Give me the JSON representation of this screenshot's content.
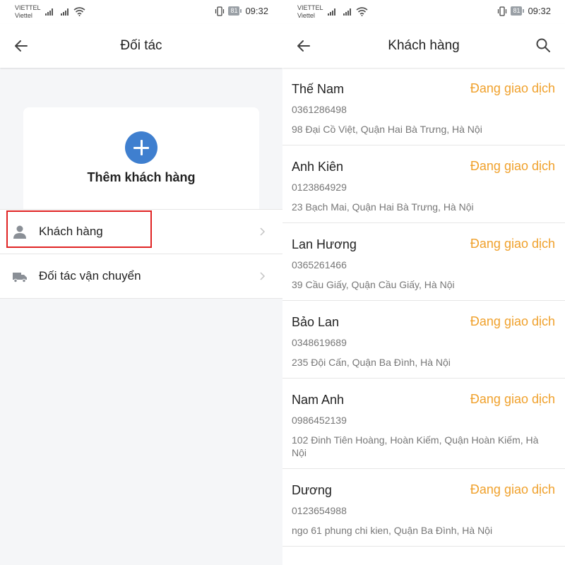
{
  "status_left": {
    "carrier_top": "VIETTEL",
    "carrier_bottom": "Viettel",
    "battery": "81",
    "time": "09:32"
  },
  "status_right": {
    "carrier_top": "VIETTEL",
    "carrier_bottom": "Viettel",
    "battery": "81",
    "time": "09:32"
  },
  "partners_screen": {
    "title": "Đối tác",
    "add_customer_label": "Thêm khách hàng",
    "menu": [
      {
        "label": "Khách hàng",
        "icon": "person-icon"
      },
      {
        "label": "Đối tác vận chuyển",
        "icon": "truck-icon"
      }
    ],
    "highlight_color": "#e02424"
  },
  "customers_screen": {
    "title": "Khách hàng",
    "status_color": "#f0a12c",
    "customers": [
      {
        "name": "Thế Nam",
        "status": "Đang giao dịch",
        "phone": "0361286498",
        "address": "98 Đại Cồ Việt, Quận Hai Bà Trưng, Hà Nội"
      },
      {
        "name": "Anh Kiên",
        "status": "Đang giao dịch",
        "phone": "0123864929",
        "address": "23 Bạch Mai, Quận Hai Bà Trưng, Hà Nội"
      },
      {
        "name": "Lan Hương",
        "status": "Đang giao dịch",
        "phone": "0365261466",
        "address": "39 Cầu Giấy, Quận Cầu Giấy, Hà Nội"
      },
      {
        "name": "Bảo Lan",
        "status": "Đang giao dịch",
        "phone": "0348619689",
        "address": "235 Đội Cấn, Quận Ba Đình, Hà Nội"
      },
      {
        "name": "Nam Anh",
        "status": "Đang giao dịch",
        "phone": "0986452139",
        "address": "102 Đinh Tiên Hoàng, Hoàn Kiếm, Quận Hoàn Kiếm, Hà Nội"
      },
      {
        "name": "Dương",
        "status": "Đang giao dịch",
        "phone": "0123654988",
        "address": "ngo 61 phung chi kien, Quận Ba Đình, Hà Nội"
      }
    ]
  },
  "icons": {
    "back": "arrow-left-icon",
    "search": "search-icon",
    "add": "plus-icon",
    "chevron": "chevron-right-icon"
  }
}
